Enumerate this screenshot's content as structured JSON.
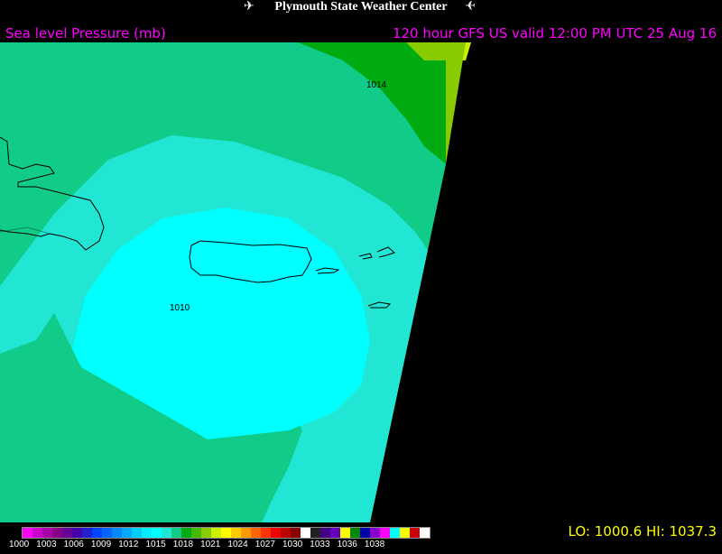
{
  "header": {
    "title": "Plymouth State Weather Center",
    "left_subtitle": "Sea level Pressure (mb)",
    "right_subtitle": "120 hour GFS US valid 12:00 PM UTC 25 Aug 16",
    "bird_icon": "bird-icon"
  },
  "map": {
    "contour_labels": [
      "1014",
      "1010"
    ],
    "fill_colors": {
      "lowest": "#00ffff",
      "low": "#22e6d4",
      "mid": "#11cc88",
      "high": "#00aa11",
      "higher": "#88cc00",
      "highest": "#ccee00",
      "no_data": "#000000"
    },
    "coast_color": "#000000"
  },
  "footer": {
    "lohi": "LO: 1000.6   HI: 1037.3"
  },
  "legend": {
    "labels": [
      "1000",
      "1003",
      "1006",
      "1009",
      "1012",
      "1015",
      "1018",
      "1021",
      "1024",
      "1027",
      "1030",
      "1033",
      "1036",
      "1038"
    ],
    "colors": [
      "#ff00ff",
      "#cc00cc",
      "#aa00aa",
      "#880088",
      "#660099",
      "#4400aa",
      "#2222cc",
      "#0044ff",
      "#0066ff",
      "#0088ff",
      "#00aaff",
      "#00ccff",
      "#00eeff",
      "#00ffff",
      "#22e6d4",
      "#11cc88",
      "#00aa11",
      "#44bb00",
      "#88cc00",
      "#ccee00",
      "#ffff00",
      "#ffcc00",
      "#ff9900",
      "#ff6600",
      "#ff3300",
      "#ee0000",
      "#bb0000",
      "#880000",
      "#ffffff",
      "#222222",
      "#440088",
      "#6600bb",
      "#ffff00",
      "#008800",
      "#0000aa",
      "#8800cc",
      "#ff00ff",
      "#00ffff",
      "#ffff00",
      "#cc0000",
      "#ffffff"
    ]
  }
}
